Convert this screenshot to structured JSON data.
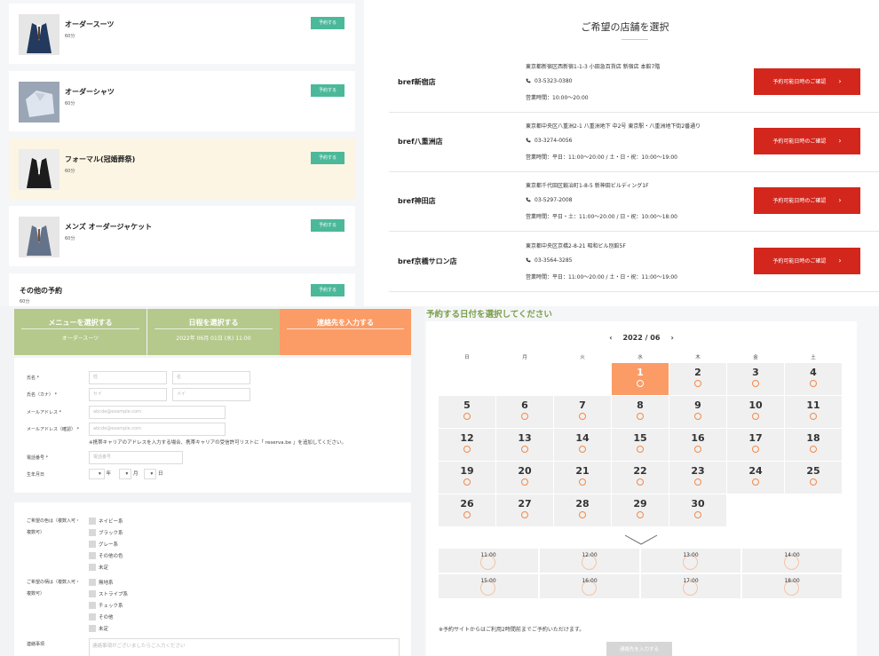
{
  "menu": {
    "items": [
      {
        "title": "オーダースーツ",
        "duration": "60分",
        "button": "予約する"
      },
      {
        "title": "オーダーシャツ",
        "duration": "60分",
        "button": "予約する"
      },
      {
        "title": "フォーマル(冠婚葬祭)",
        "duration": "60分",
        "button": "予約する"
      },
      {
        "title": "メンズ オーダージャケット",
        "duration": "60分",
        "button": "予約する"
      },
      {
        "title": "その他の予約",
        "duration": "60分",
        "button": "予約する"
      }
    ]
  },
  "stores": {
    "heading": "ご希望の店舗を選択",
    "button_label": "予約可能日時のご確認",
    "items": [
      {
        "name": "bref新宿店",
        "address": "東京都新宿区西新宿1-1-3 小田急百貨店 新宿店 本館7階",
        "phone": "03-5323-0380",
        "hours": "営業時間：10:00～20:00"
      },
      {
        "name": "bref八重洲店",
        "address": "東京都中央区八重洲2-1 八重洲地下 中2号 東京駅・八重洲地下街2番通り",
        "phone": "03-3274-0056",
        "hours": "営業時間：平日：11:00～20:00 / 土・日・祝：10:00～19:00"
      },
      {
        "name": "bref神田店",
        "address": "東京都千代田区鍛冶町1-8-5 新神田ビルディング1F",
        "phone": "03-5297-2008",
        "hours": "営業時間：平日・土：11:00～20:00 / 日・祝：10:00～18:00"
      },
      {
        "name": "bref京橋サロン店",
        "address": "東京都中央区京橋2-8-21 昭和ビル別館5F",
        "phone": "03-3564-3285",
        "hours": "営業時間：平日：11:00～20:00 / 土・日・祝：11:00～19:00"
      }
    ]
  },
  "steps": [
    {
      "title": "メニューを選択する",
      "value": "オーダースーツ"
    },
    {
      "title": "日程を選択する",
      "value": "2022年 06月 01日 (水) 11:00"
    },
    {
      "title": "連絡先を入力する",
      "value": ""
    }
  ],
  "form": {
    "name_label": "氏名 *",
    "name_last_ph": "姓",
    "name_first_ph": "名",
    "kana_label": "氏名（カナ） *",
    "kana_last_ph": "セイ",
    "kana_first_ph": "メイ",
    "email_label": "メールアドレス *",
    "email_ph": "abcde@example.com",
    "email_confirm_label": "メールアドレス（確認） *",
    "email_confirm_ph": "abcde@example.com",
    "email_note": "※携帯キャリアのアドレスを入力する場合、携帯キャリアの受信許可リストに「 reserva.be 」を追加してください。",
    "phone_label": "電話番号 *",
    "phone_ph": "電話番号",
    "birth_label": "生年月日",
    "birth_year": "年",
    "birth_month": "月",
    "birth_day": "日",
    "color_label_1": "ご希望の色は（複数入可・",
    "color_label_2": "複数可）",
    "colors": [
      "ネイビー系",
      "ブラック系",
      "グレー系",
      "その他の色",
      "未定"
    ],
    "pattern_label_1": "ご希望の柄は（複数入可・",
    "pattern_label_2": "複数可）",
    "patterns": [
      "無地系",
      "ストライプ系",
      "チェック系",
      "その他",
      "未定"
    ],
    "notes_label": "連絡事項",
    "notes_ph": "連絡事項がございましたらご入力ください"
  },
  "calendar": {
    "heading": "予約する日付を選択してください",
    "month": "2022 / 06",
    "weekdays": [
      "日",
      "月",
      "火",
      "水",
      "木",
      "金",
      "土"
    ],
    "days": [
      "1",
      "2",
      "3",
      "4",
      "5",
      "6",
      "7",
      "8",
      "9",
      "10",
      "11",
      "12",
      "13",
      "14",
      "15",
      "16",
      "17",
      "18",
      "19",
      "20",
      "21",
      "22",
      "23",
      "24",
      "25",
      "26",
      "27",
      "28",
      "29",
      "30"
    ],
    "selected_day": "1",
    "times": [
      "11:00",
      "12:00",
      "13:00",
      "14:00",
      "15:00",
      "16:00",
      "17:00",
      "18:00"
    ],
    "note": "※予約サイトからはご利用2時間前までご予約いただけます。",
    "submit": "連絡先を入力する"
  },
  "colors": {
    "reserve_green": "#4cb89a",
    "store_red": "#d3271d",
    "step_done": "#b5c98c",
    "step_active": "#fb9c66",
    "calendar_heading": "#7a9e48"
  }
}
